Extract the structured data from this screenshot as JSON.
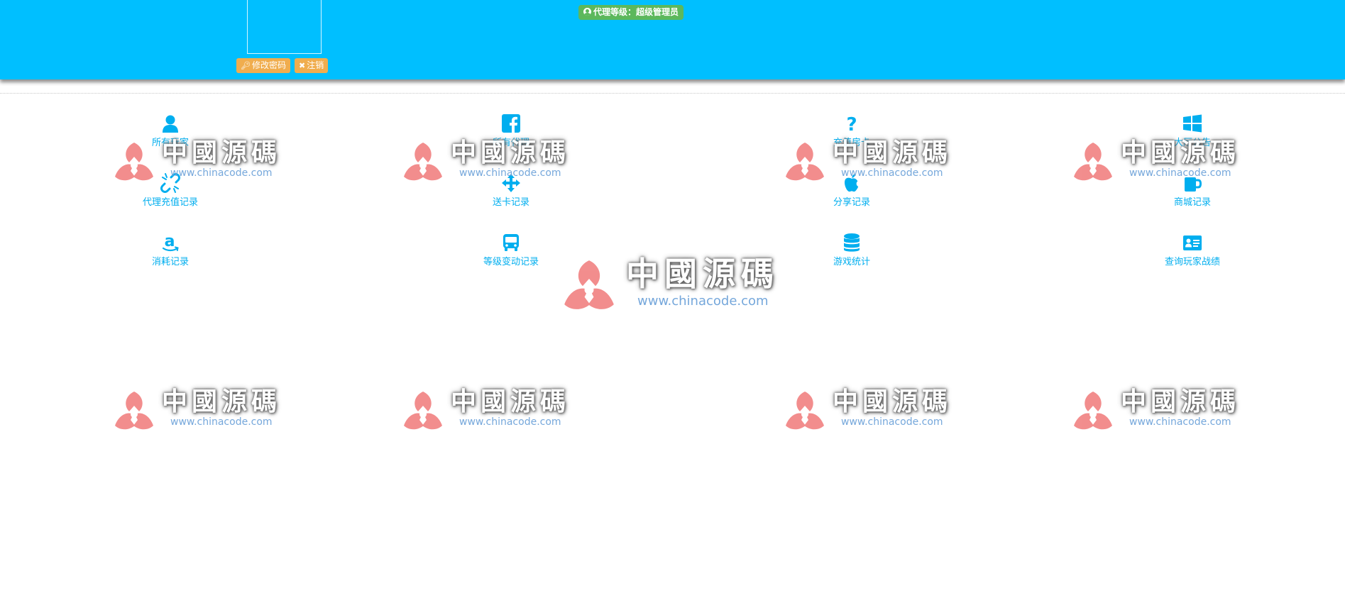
{
  "header": {
    "level_label": "代理等级：超级管理员",
    "change_password": "修改密码",
    "logout": "注销"
  },
  "menu": [
    {
      "label": "所有玩家",
      "icon": "user-icon"
    },
    {
      "label": "所有代理",
      "icon": "facebook-icon"
    },
    {
      "label": "充值房卡",
      "icon": "question-icon"
    },
    {
      "label": "大厅公告",
      "icon": "windows-icon"
    },
    {
      "label": "代理充值记录",
      "icon": "unlink-icon"
    },
    {
      "label": "送卡记录",
      "icon": "arrows-move-icon"
    },
    {
      "label": "分享记录",
      "icon": "apple-icon"
    },
    {
      "label": "商城记录",
      "icon": "mug-icon"
    },
    {
      "label": "消耗记录",
      "icon": "amazon-icon"
    },
    {
      "label": "等级变动记录",
      "icon": "bus-icon"
    },
    {
      "label": "游戏统计",
      "icon": "database-icon"
    },
    {
      "label": "查询玩家战绩",
      "icon": "id-card-icon"
    }
  ],
  "watermark": {
    "brand": "中國源碼",
    "url": "www.chinacode.com"
  },
  "colors": {
    "header_bg": "#00bfff",
    "accent": "#00aeef",
    "badge": "#5cb85c",
    "button": "#f0ad4e"
  }
}
